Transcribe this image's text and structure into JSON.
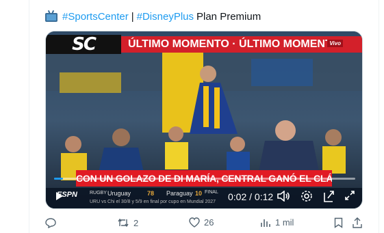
{
  "tweet": {
    "emoji": "tv-icon",
    "hashtag1": "#SportsCenter",
    "separator": "|",
    "hashtag2": "#DisneyPlus",
    "plan": "Plan Premium"
  },
  "video": {
    "logo": "SC",
    "breaking_banner": "ÚLTIMO MOMENTO · ÚLTIMO MOMENTO",
    "live_badge": "Vivo",
    "headline": "CON UN GOLAZO DE DI MARÍA, CENTRAL GANÓ EL CLÁSICO EN ARROYITO",
    "progress": 0.03,
    "time_current": "0:02",
    "time_total": "0:12",
    "ticker": {
      "network": "ESPN",
      "sport": "RUGBY",
      "team1": "Uruguay",
      "score1": "78",
      "team2": "Paraguay",
      "score2": "10",
      "status": "FINAL",
      "sub": "URU vs Chi el 30/8 y 5/9 en final por cupo en Mundial 2027"
    }
  },
  "actions": {
    "replies": "",
    "retweets": "2",
    "likes": "26",
    "views": "1 mil"
  },
  "colors": {
    "accent": "#1d9bf0",
    "breaking_red": "#d3202a",
    "icon_gray": "#536471"
  }
}
